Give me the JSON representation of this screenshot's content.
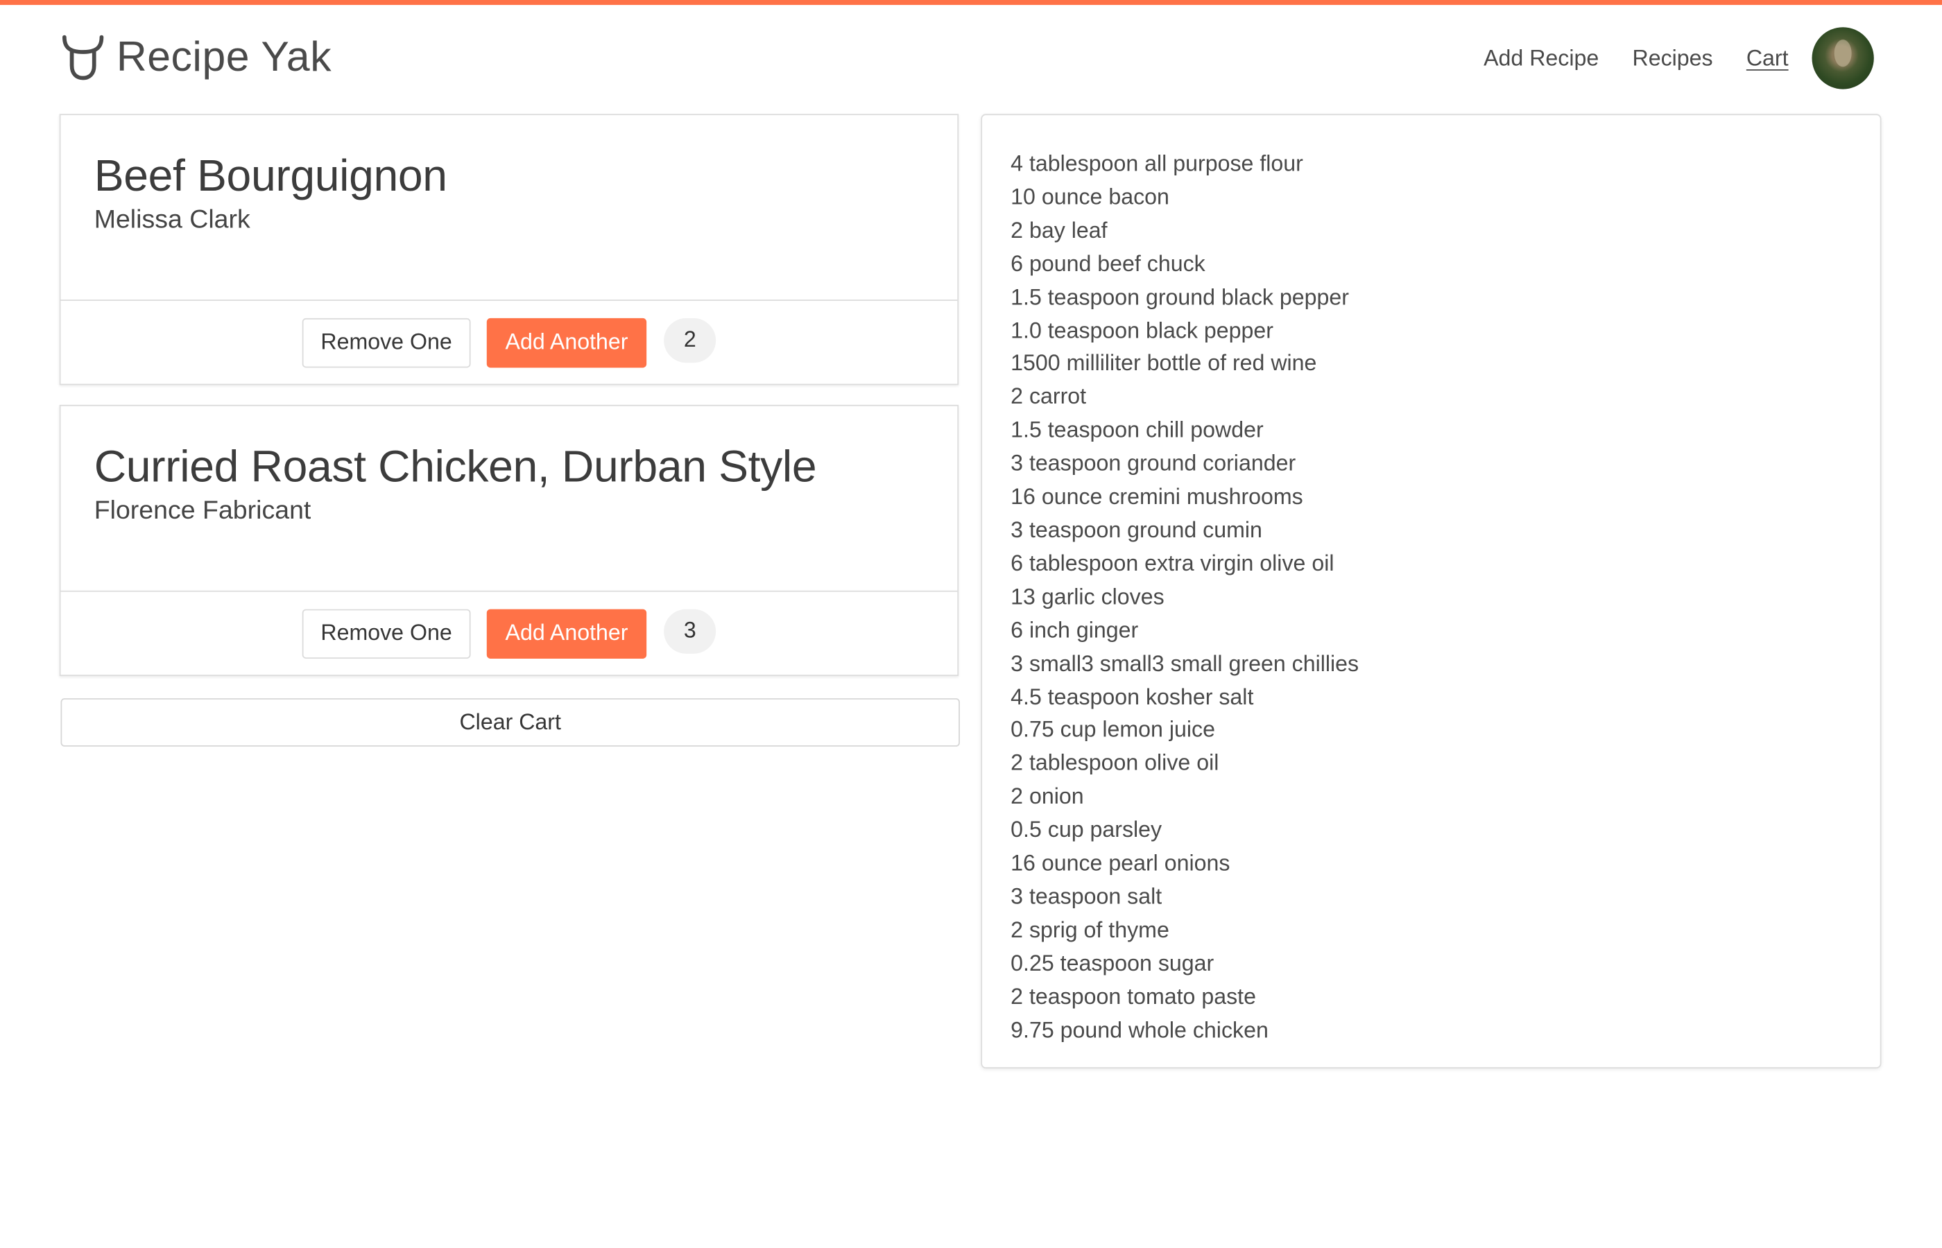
{
  "brand": {
    "name": "Recipe Yak",
    "icon": "bull-horns-icon",
    "accent_color": "#ff7247"
  },
  "nav": {
    "links": [
      {
        "label": "Add Recipe"
      },
      {
        "label": "Recipes"
      },
      {
        "label": "Cart",
        "active": true
      }
    ],
    "avatar": "user-avatar"
  },
  "cart": {
    "recipes": [
      {
        "title": "Beef Bourguignon",
        "author": "Melissa Clark",
        "remove_label": "Remove One",
        "add_label": "Add Another",
        "count": "2"
      },
      {
        "title": "Curried Roast Chicken, Durban Style",
        "author": "Florence Fabricant",
        "remove_label": "Remove One",
        "add_label": "Add Another",
        "count": "3"
      }
    ],
    "clear_label": "Clear Cart"
  },
  "ingredients": [
    "4 tablespoon all purpose flour",
    "10 ounce bacon",
    "2 bay leaf",
    "6 pound beef chuck",
    "1.5 teaspoon ground black pepper",
    "1.0 teaspoon black pepper",
    "1500 milliliter bottle of red wine",
    "2 carrot",
    "1.5 teaspoon chill powder",
    "3 teaspoon ground coriander",
    "16 ounce cremini mushrooms",
    "3 teaspoon ground cumin",
    "6 tablespoon extra virgin olive oil",
    "13 garlic cloves",
    "6 inch ginger",
    "3 small3 small3 small green chillies",
    "4.5 teaspoon kosher salt",
    "0.75 cup lemon juice",
    "2 tablespoon olive oil",
    "2 onion",
    "0.5 cup parsley",
    "16 ounce pearl onions",
    "3 teaspoon salt",
    "2 sprig of thyme",
    "0.25 teaspoon sugar",
    "2 teaspoon tomato paste",
    "9.75 pound whole chicken"
  ]
}
